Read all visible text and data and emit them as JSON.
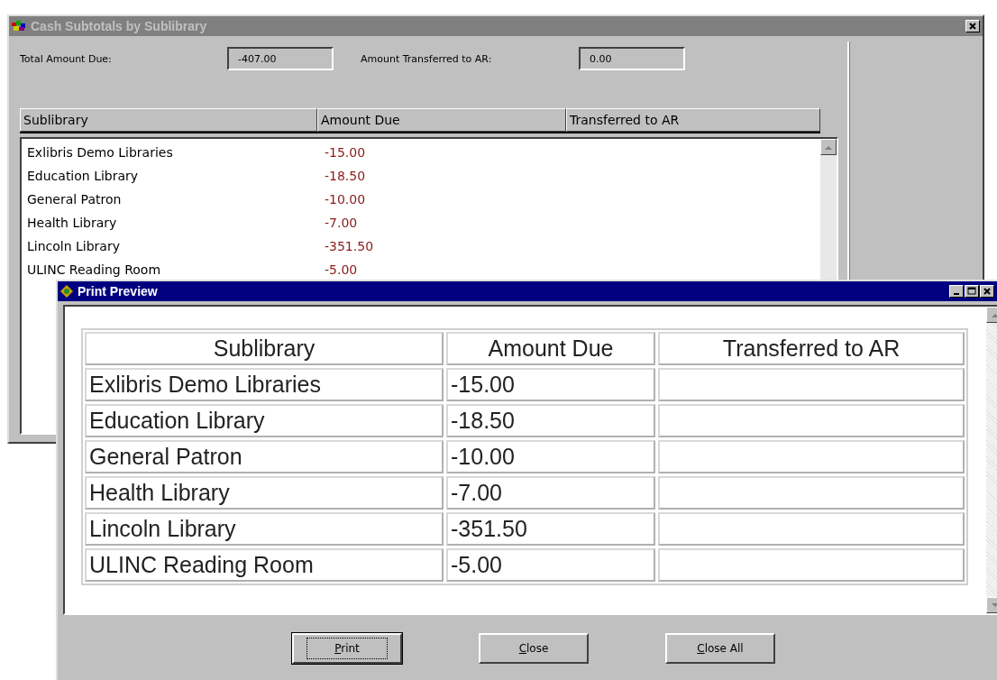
{
  "main_window": {
    "title": "Cash Subtotals by Sublibrary",
    "active": false,
    "fields": [
      {
        "label": "Total Amount Due:",
        "value": "-407.00"
      },
      {
        "label": "Amount Transferred to AR:",
        "value": "0.00"
      }
    ],
    "table": {
      "columns": [
        "Sublibrary",
        "Amount Due",
        "Transferred to AR"
      ],
      "rows": [
        {
          "sublibrary": "Exlibris Demo Libraries",
          "amount_due": "-15.00"
        },
        {
          "sublibrary": "Education Library",
          "amount_due": "-18.50"
        },
        {
          "sublibrary": "General Patron",
          "amount_due": "-10.00"
        },
        {
          "sublibrary": "Health Library",
          "amount_due": "-7.00"
        },
        {
          "sublibrary": "Lincoln Library",
          "amount_due": "-351.50"
        },
        {
          "sublibrary": "ULINC Reading Room",
          "amount_due": "-5.00"
        }
      ]
    }
  },
  "print_preview": {
    "title": "Print Preview",
    "active": true,
    "table": {
      "columns": [
        "Sublibrary",
        "Amount Due",
        "Transferred to AR"
      ],
      "rows": [
        {
          "sublibrary": "Exlibris Demo Libraries",
          "amount_due": "-15.00"
        },
        {
          "sublibrary": "Education Library",
          "amount_due": "-18.50"
        },
        {
          "sublibrary": "General Patron",
          "amount_due": "-10.00"
        },
        {
          "sublibrary": "Health Library",
          "amount_due": "-7.00"
        },
        {
          "sublibrary": "Lincoln Library",
          "amount_due": "-351.50"
        },
        {
          "sublibrary": "ULINC Reading Room",
          "amount_due": "-5.00"
        }
      ]
    },
    "buttons": [
      {
        "label": "Print",
        "default": true,
        "mnemonic_underlined": true
      },
      {
        "label": "Close",
        "default": false,
        "mnemonic_underlined": true
      },
      {
        "label": "Close All",
        "default": false,
        "mnemonic_underlined": true
      }
    ]
  }
}
